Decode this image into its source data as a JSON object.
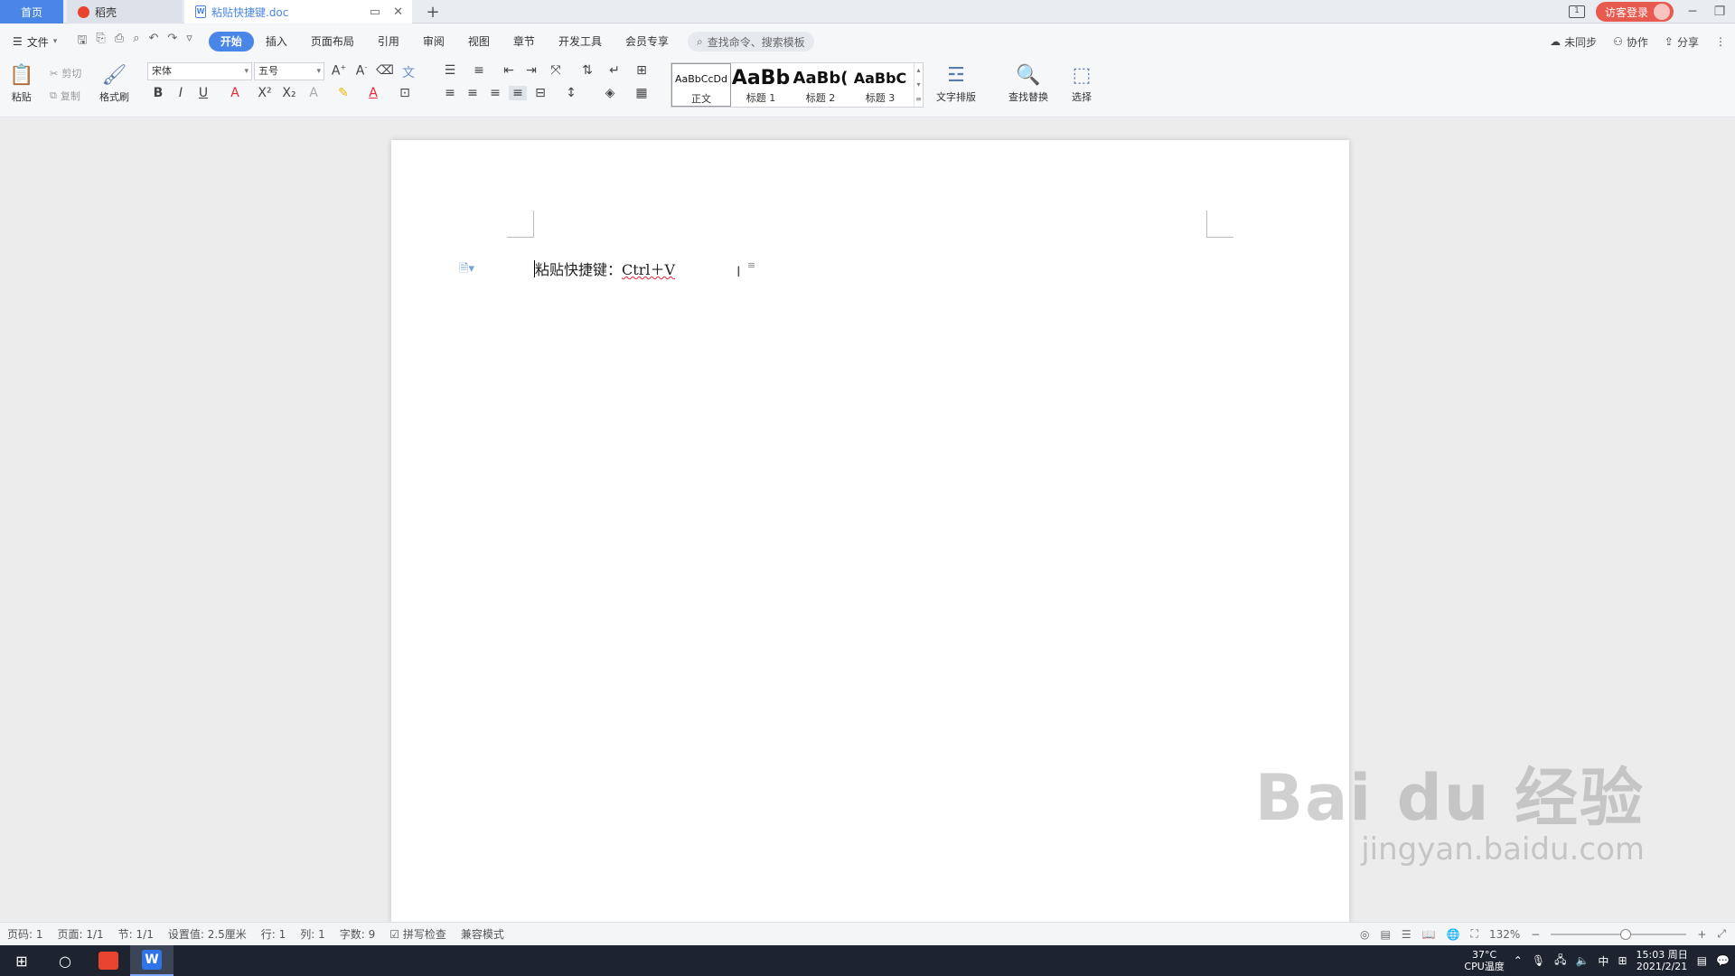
{
  "titlebar": {
    "home_tab": "首页",
    "docer_tab": "稻壳",
    "doc_tab": "粘贴快捷键.doc",
    "new_tab_symbol": "+",
    "sidebar_badge": "1",
    "login_label": "访客登录"
  },
  "menu": {
    "file_label": "文件",
    "tabs": [
      "开始",
      "插入",
      "页面布局",
      "引用",
      "审阅",
      "视图",
      "章节",
      "开发工具",
      "会员专享"
    ],
    "search_placeholder": "查找命令、搜索模板",
    "unsync_label": "未同步",
    "collab_label": "协作",
    "share_label": "分享"
  },
  "ribbon": {
    "paste": "粘贴",
    "cut": "剪切",
    "copy": "复制",
    "format_painter": "格式刷",
    "font_name": "宋体",
    "font_size": "五号",
    "styles": [
      {
        "sample": "AaBbCcDd",
        "name": "正文"
      },
      {
        "sample": "AaBb",
        "name": "标题 1"
      },
      {
        "sample": "AaBb(",
        "name": "标题 2"
      },
      {
        "sample": "AaBbC",
        "name": "标题 3"
      }
    ],
    "text_layout": "文字排版",
    "find_replace": "查找替换",
    "select": "选择"
  },
  "document": {
    "text_main": "粘贴快捷键：",
    "text_shortcut": "Ctrl＋V"
  },
  "statusbar": {
    "page_num": "页码: 1",
    "pages": "页面: 1/1",
    "section": "节: 1/1",
    "setting": "设置值: 2.5厘米",
    "row": "行: 1",
    "col": "列: 1",
    "word_count": "字数: 9",
    "spell_check": "拼写检查",
    "compat_mode": "兼容模式",
    "zoom": "132%",
    "zoom_fraction": 0.55
  },
  "taskbar": {
    "temperature": "37°C",
    "cpu_label": "CPU温度",
    "ime": "中",
    "time": "15:03 周日",
    "date": "2021/2/21"
  },
  "watermark": {
    "brand": "Bai du 经验",
    "url": "jingyan.baidu.com"
  },
  "colors": {
    "accent": "#4a86e8",
    "login": "#e85a4f",
    "taskbar": "#1d2430"
  }
}
